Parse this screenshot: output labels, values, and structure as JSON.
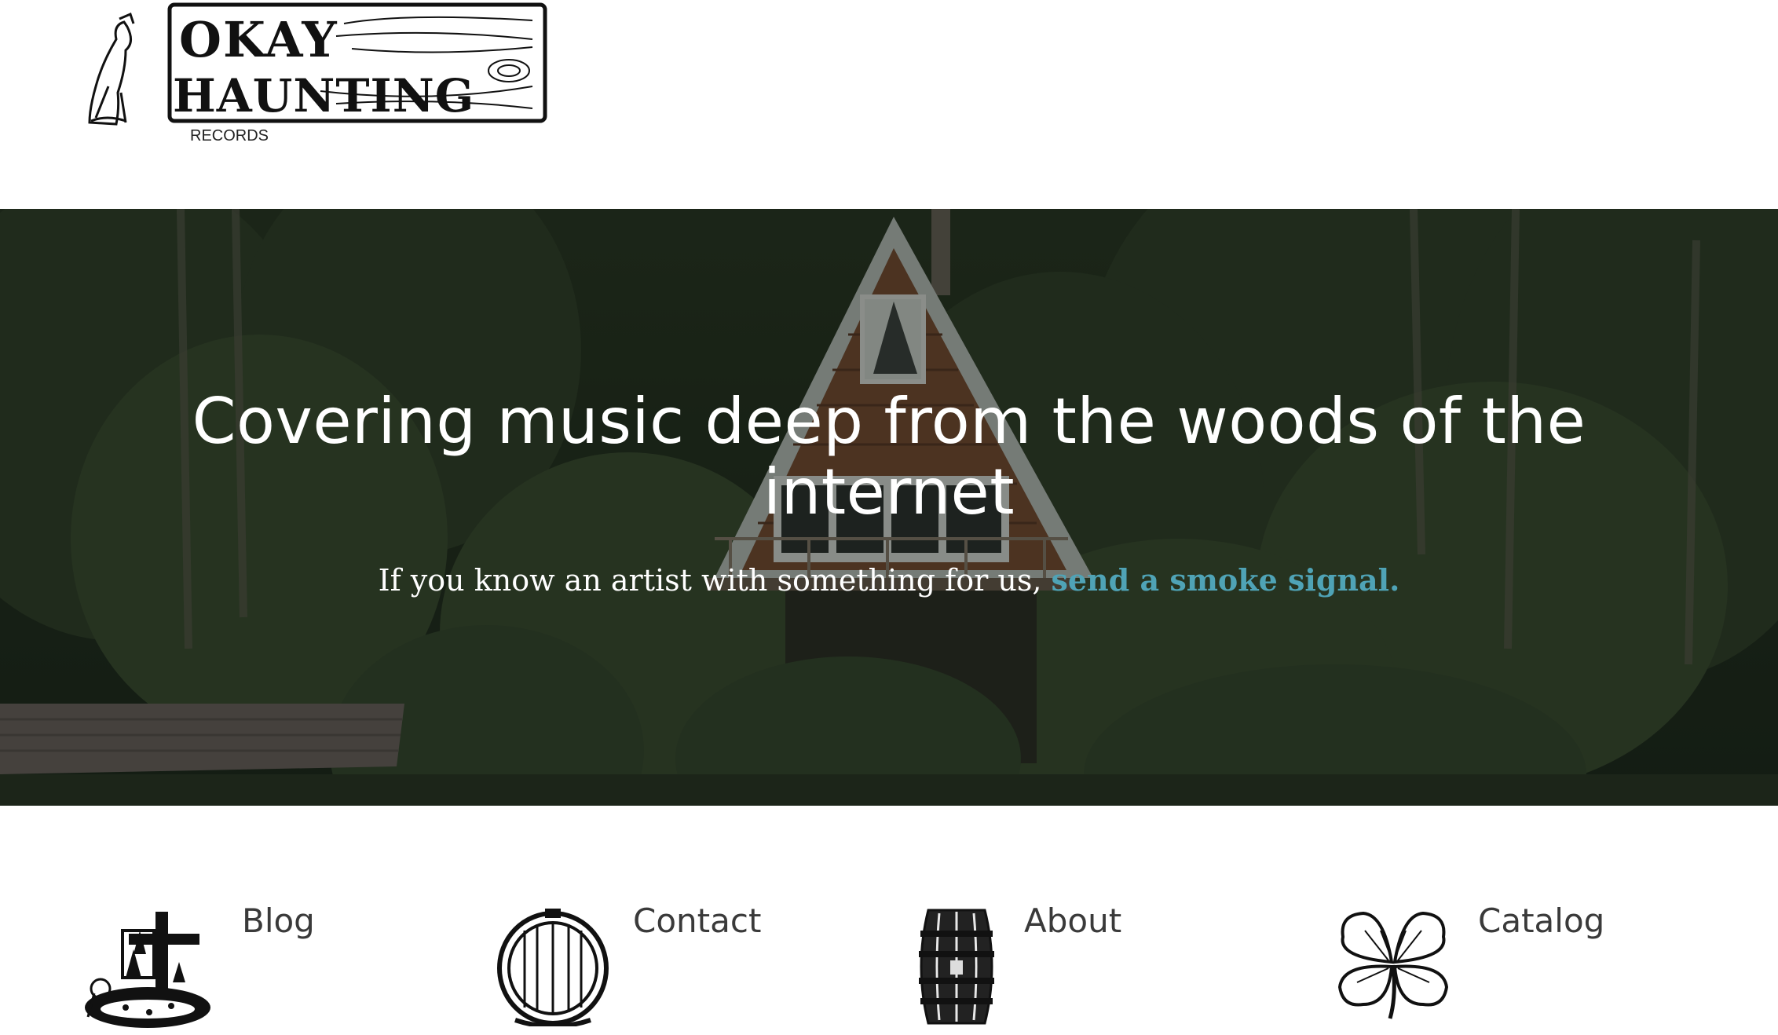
{
  "header": {
    "logo_line1": "OKAY",
    "logo_line2": "HAUNTING",
    "logo_sub": "RECORDS"
  },
  "hero": {
    "title": "Covering music deep from the woods of the internet",
    "subtitle_text": "If you know an artist with something for us, ",
    "subtitle_link": "send a smoke signal."
  },
  "nav": [
    {
      "label": "Blog",
      "icon": "grave-cross-icon"
    },
    {
      "label": "Contact",
      "icon": "barrel-end-icon"
    },
    {
      "label": "About",
      "icon": "barrel-icon"
    },
    {
      "label": "Catalog",
      "icon": "four-leaf-clover-icon"
    }
  ],
  "colors": {
    "link": "#4fa3b6",
    "nav_text": "#3a3a3a",
    "hero_text": "#ffffff"
  }
}
